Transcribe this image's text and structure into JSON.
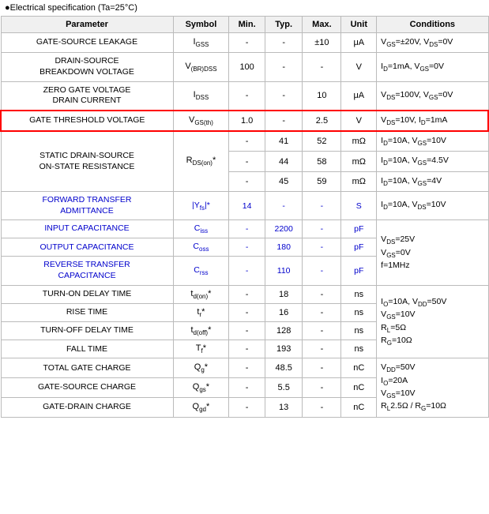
{
  "header": {
    "title": "●Electrical specification (Ta=25°C)"
  },
  "table": {
    "columns": [
      "Parameter",
      "Symbol",
      "Min.",
      "Typ.",
      "Max.",
      "Unit",
      "Conditions"
    ],
    "rows": [
      {
        "param": "GATE-SOURCE LEAKAGE",
        "symbol": "IGSS",
        "min": "-",
        "typ": "-",
        "max": "±10",
        "unit": "μA",
        "conditions": "VGS=±20V, VDS=0V",
        "highlight": false,
        "blue": false,
        "rowspan": 1
      },
      {
        "param": "DRAIN-SOURCE BREAKDOWN VOLTAGE",
        "symbol": "V(BR)DSS",
        "min": "100",
        "typ": "-",
        "max": "-",
        "unit": "V",
        "conditions": "ID=1mA, VGS=0V",
        "highlight": false,
        "blue": false,
        "rowspan": 1
      },
      {
        "param": "ZERO GATE VOLTAGE DRAIN CURRENT",
        "symbol": "IDSS",
        "min": "-",
        "typ": "-",
        "max": "10",
        "unit": "μA",
        "conditions": "VDS=100V, VGS=0V",
        "highlight": false,
        "blue": false,
        "rowspan": 1
      },
      {
        "param": "GATE THRESHOLD VOLTAGE",
        "symbol": "VGS(th)",
        "min": "1.0",
        "typ": "-",
        "max": "2.5",
        "unit": "V",
        "conditions": "VDS=10V, ID=1mA",
        "highlight": true,
        "blue": false,
        "rowspan": 1
      },
      {
        "param": "STATIC DRAIN-SOURCE ON-STATE RESISTANCE",
        "symbol": "RDS(on)*",
        "rows3": [
          {
            "min": "-",
            "typ": "41",
            "max": "52",
            "unit": "mΩ",
            "conditions": "ID=10A, VGS=10V"
          },
          {
            "min": "-",
            "typ": "44",
            "max": "58",
            "unit": "mΩ",
            "conditions": "ID=10A, VGS=4.5V"
          },
          {
            "min": "-",
            "typ": "45",
            "max": "59",
            "unit": "mΩ",
            "conditions": "ID=10A, VGS=4V"
          }
        ],
        "highlight": false,
        "blue": false,
        "multi": true
      },
      {
        "param": "FORWARD TRANSFER ADMITTANCE",
        "symbol": "|Yfs|*",
        "min": "14",
        "typ": "-",
        "max": "-",
        "unit": "S",
        "conditions": "ID=10A, VDS=10V",
        "highlight": false,
        "blue": true,
        "rowspan": 1
      },
      {
        "param": "INPUT CAPACITANCE",
        "symbol": "Ciss",
        "min": "-",
        "typ": "2200",
        "max": "-",
        "unit": "pF",
        "conditions": "",
        "highlight": false,
        "blue": true,
        "rowspan": 1,
        "cond_rowspan": 3,
        "cond_text": "VDS=25V\nVGS=0V\nf=1MHz"
      },
      {
        "param": "OUTPUT CAPACITANCE",
        "symbol": "Coss",
        "min": "-",
        "typ": "180",
        "max": "-",
        "unit": "pF",
        "conditions": "",
        "highlight": false,
        "blue": true,
        "rowspan": 1
      },
      {
        "param": "REVERSE TRANSFER CAPACITANCE",
        "symbol": "Crss",
        "min": "-",
        "typ": "110",
        "max": "-",
        "unit": "pF",
        "conditions": "",
        "highlight": false,
        "blue": true,
        "rowspan": 1
      },
      {
        "param": "TURN-ON DELAY TIME",
        "symbol": "td(on)*",
        "min": "-",
        "typ": "18",
        "max": "-",
        "unit": "ns",
        "conditions": "",
        "highlight": false,
        "blue": false,
        "rowspan": 1,
        "cond_rowspan": 4,
        "cond_text": "IO=10A, VDD=50V\nVGS=10V\nRL=5Ω\nRG=10Ω"
      },
      {
        "param": "RISE TIME",
        "symbol": "tr*",
        "min": "-",
        "typ": "16",
        "max": "-",
        "unit": "ns",
        "conditions": "",
        "highlight": false,
        "blue": false
      },
      {
        "param": "TURN-OFF DELAY TIME",
        "symbol": "td(off)*",
        "min": "-",
        "typ": "128",
        "max": "-",
        "unit": "ns",
        "conditions": "",
        "highlight": false,
        "blue": false
      },
      {
        "param": "FALL TIME",
        "symbol": "Tf*",
        "min": "-",
        "typ": "193",
        "max": "-",
        "unit": "ns",
        "conditions": "",
        "highlight": false,
        "blue": false
      },
      {
        "param": "TOTAL GATE CHARGE",
        "symbol": "Qg*",
        "min": "-",
        "typ": "48.5",
        "max": "-",
        "unit": "nC",
        "conditions": "",
        "highlight": false,
        "blue": false,
        "cond_rowspan": 3,
        "cond_text": "VDD=50V\nIO=20A\nVGS=10V\nRL2.5Ω / RG=10Ω"
      },
      {
        "param": "GATE-SOURCE CHARGE",
        "symbol": "Qgs*",
        "min": "-",
        "typ": "5.5",
        "max": "-",
        "unit": "nC",
        "conditions": "",
        "highlight": false,
        "blue": false
      },
      {
        "param": "GATE-DRAIN CHARGE",
        "symbol": "Qgd*",
        "min": "-",
        "typ": "13",
        "max": "-",
        "unit": "nC",
        "conditions": "",
        "highlight": false,
        "blue": false
      }
    ]
  }
}
